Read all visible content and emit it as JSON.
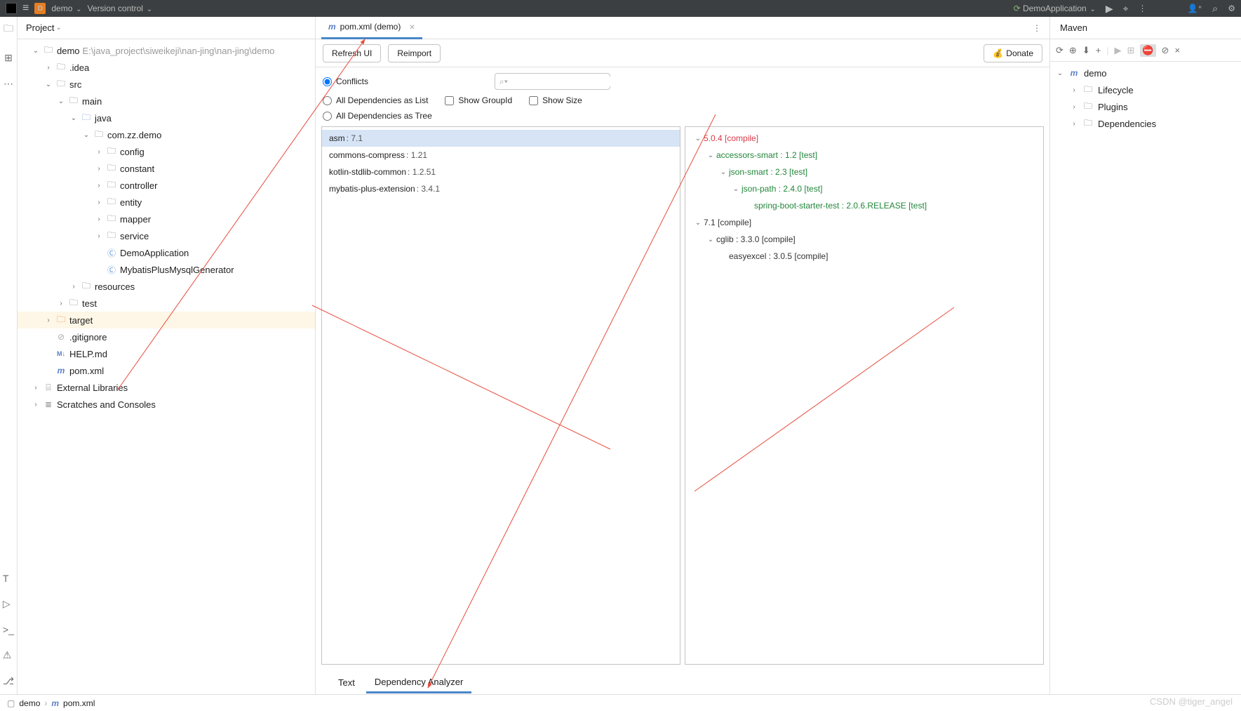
{
  "topbar": {
    "project_letter": "D",
    "project_name": "demo",
    "vcs": "Version control",
    "run_config": "DemoApplication"
  },
  "sidebar": {
    "title": "Project",
    "root": {
      "name": "demo",
      "path": "E:\\java_project\\siweikeji\\nan-jing\\nan-jing\\demo"
    },
    "tree": {
      "idea": ".idea",
      "src": "src",
      "main": "main",
      "java": "java",
      "pkg": "com.zz.demo",
      "config": "config",
      "constant": "constant",
      "controller": "controller",
      "entity": "entity",
      "mapper": "mapper",
      "service": "service",
      "app_class": "DemoApplication",
      "gen_class": "MybatisPlusMysqlGenerator",
      "resources": "resources",
      "test": "test",
      "target": "target",
      "gitignore": ".gitignore",
      "help": "HELP.md",
      "pom": "pom.xml",
      "ext_lib": "External Libraries",
      "scratches": "Scratches and Consoles"
    }
  },
  "tab": {
    "label": "pom.xml (demo)"
  },
  "toolbar": {
    "refresh": "Refresh UI",
    "reimport": "Reimport",
    "donate": "Donate"
  },
  "filters": {
    "conflicts": "Conflicts",
    "all_list": "All Dependencies as List",
    "all_tree": "All Dependencies as Tree",
    "show_groupid": "Show GroupId",
    "show_size": "Show Size",
    "search_placeholder": ""
  },
  "deps_left": [
    {
      "name": "asm",
      "ver": ": 7.1"
    },
    {
      "name": "commons-compress",
      "ver": ": 1.21"
    },
    {
      "name": "kotlin-stdlib-common",
      "ver": ": 1.2.51"
    },
    {
      "name": "mybatis-plus-extension",
      "ver": ": 3.4.1"
    }
  ],
  "deps_right": [
    {
      "indent": 0,
      "toggle": "v",
      "cls": "dt-red",
      "text": "5.0.4 [compile]"
    },
    {
      "indent": 1,
      "toggle": "v",
      "cls": "dt-green",
      "text": "accessors-smart : 1.2 [test]"
    },
    {
      "indent": 2,
      "toggle": "v",
      "cls": "dt-green",
      "text": "json-smart : 2.3 [test]"
    },
    {
      "indent": 3,
      "toggle": "v",
      "cls": "dt-green",
      "text": "json-path : 2.4.0 [test]"
    },
    {
      "indent": 4,
      "toggle": "",
      "cls": "dt-green",
      "text": "spring-boot-starter-test : 2.0.6.RELEASE [test]"
    },
    {
      "indent": 0,
      "toggle": "v",
      "cls": "dt-dark",
      "text": "7.1 [compile]"
    },
    {
      "indent": 1,
      "toggle": "v",
      "cls": "dt-dark",
      "text": "cglib : 3.3.0 [compile]"
    },
    {
      "indent": 2,
      "toggle": "",
      "cls": "dt-dark",
      "text": "easyexcel : 3.0.5 [compile]"
    }
  ],
  "bottom_tabs": {
    "text": "Text",
    "analyzer": "Dependency Analyzer"
  },
  "maven": {
    "title": "Maven",
    "root": "demo",
    "lifecycle": "Lifecycle",
    "plugins": "Plugins",
    "dependencies": "Dependencies"
  },
  "breadcrumb": {
    "project": "demo",
    "file": "pom.xml"
  },
  "watermark": "CSDN @tiger_angel"
}
